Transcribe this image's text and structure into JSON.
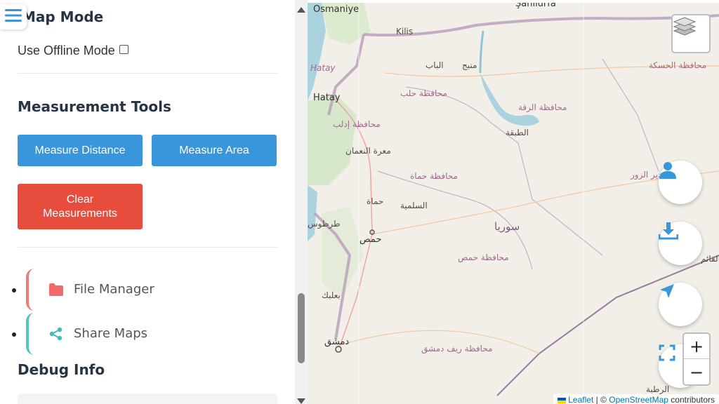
{
  "sidebar": {
    "map_mode_title": "Map Mode",
    "offline_label": "Use Offline Mode",
    "offline_checked": false,
    "measurement_title": "Measurement Tools",
    "measure_distance": "Measure Distance",
    "measure_area": "Measure Area",
    "clear_measurements": "Clear Measurements",
    "menu_items": [
      {
        "label": "File Manager",
        "icon": "folder-icon",
        "color": "#f07b7b"
      },
      {
        "label": "Share Maps",
        "icon": "share-icon",
        "color": "#4dc7c0"
      }
    ],
    "debug_title": "Debug Info"
  },
  "map": {
    "places": {
      "osmaniye": "Osmaniye",
      "sanliurfa": "Şanlıurfa",
      "kilis": "Kilis",
      "hatay_label": "Hatay",
      "hatay_city": "Hatay",
      "al_bab": "الباب",
      "manbij": "منبج",
      "hasakah_gov": "محافظة الحسكة",
      "aleppo_gov": "محافظة حلب",
      "raqqa_gov": "محافظة الرقة",
      "tabqa": "الطبقة",
      "idlib_gov": "محافظة إدلب",
      "maarrat": "معرة النعمان",
      "hama_gov": "محافظة حماة",
      "hama": "حماة",
      "salamiyah": "السلمية",
      "syria": "سوريا",
      "homs": "حمص",
      "homs_gov": "محافظة حمص",
      "tartus": "طرطوس",
      "deir_gov": "محافظة دير الزور",
      "baalbek": "بعلبك",
      "damascus": "دمشق",
      "rif_dimashq": "محافظة ريف دمشق",
      "qaim": "القائم",
      "rutba": "الرطبة"
    },
    "zoom_in": "+",
    "zoom_out": "−",
    "attribution": {
      "leaflet": "Leaflet",
      "separator": " | © ",
      "osm": "OpenStreetMap",
      "contributors": " contributors"
    },
    "controls": [
      "user-icon",
      "download-icon",
      "navigation-arrow-icon",
      "fullscreen-icon",
      "layers-icon"
    ]
  },
  "colors": {
    "primary_button": "#3a96db",
    "danger_button": "#e74c3c",
    "heading": "#263445",
    "control_icon": "#3a96db"
  }
}
